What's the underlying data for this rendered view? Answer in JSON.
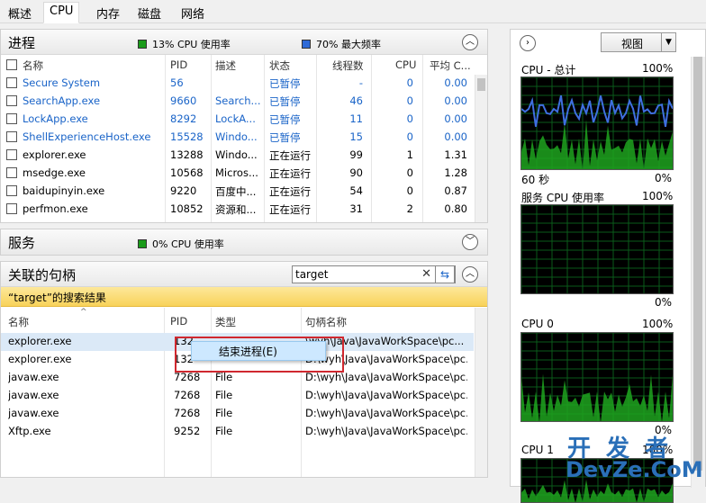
{
  "tabs": [
    "概述",
    "CPU",
    "内存",
    "磁盘",
    "网络"
  ],
  "active_tab": "CPU",
  "processes": {
    "title": "进程",
    "cpu_usage": "13% CPU 使用率",
    "max_freq": "70% 最大频率",
    "columns": [
      "名称",
      "PID",
      "描述",
      "状态",
      "线程数",
      "CPU",
      "平均 C..."
    ],
    "rows": [
      {
        "name": "Secure System",
        "pid": "56",
        "desc": "",
        "status": "已暂停",
        "threads": "-",
        "cpu": "0",
        "avg": "0.00",
        "blue": true
      },
      {
        "name": "SearchApp.exe",
        "pid": "9660",
        "desc": "Search...",
        "status": "已暂停",
        "threads": "46",
        "cpu": "0",
        "avg": "0.00",
        "blue": true
      },
      {
        "name": "LockApp.exe",
        "pid": "8292",
        "desc": "LockA...",
        "status": "已暂停",
        "threads": "11",
        "cpu": "0",
        "avg": "0.00",
        "blue": true
      },
      {
        "name": "ShellExperienceHost.exe",
        "pid": "15528",
        "desc": "Windo...",
        "status": "已暂停",
        "threads": "15",
        "cpu": "0",
        "avg": "0.00",
        "blue": true
      },
      {
        "name": "explorer.exe",
        "pid": "13288",
        "desc": "Windo...",
        "status": "正在运行",
        "threads": "99",
        "cpu": "1",
        "avg": "1.31",
        "blue": false
      },
      {
        "name": "msedge.exe",
        "pid": "10568",
        "desc": "Micros...",
        "status": "正在运行",
        "threads": "90",
        "cpu": "0",
        "avg": "1.28",
        "blue": false
      },
      {
        "name": "baidupinyin.exe",
        "pid": "9220",
        "desc": "百度中...",
        "status": "正在运行",
        "threads": "54",
        "cpu": "0",
        "avg": "0.87",
        "blue": false
      },
      {
        "name": "perfmon.exe",
        "pid": "10852",
        "desc": "资源和...",
        "status": "正在运行",
        "threads": "31",
        "cpu": "2",
        "avg": "0.80",
        "blue": false
      }
    ]
  },
  "services": {
    "title": "服务",
    "cpu_usage": "0% CPU 使用率"
  },
  "handles": {
    "title": "关联的句柄",
    "search_value": "target",
    "result_banner": "“target”的搜索结果",
    "columns": [
      "名称",
      "PID",
      "类型",
      "句柄名称"
    ],
    "rows": [
      {
        "name": "explorer.exe",
        "pid": "132",
        "type": "",
        "handle": "\\wyh\\Java\\JavaWorkSpace\\pc..."
      },
      {
        "name": "explorer.exe",
        "pid": "132",
        "type": "",
        "handle": "D:\\wyh\\Java\\JavaWorkSpace\\pc..."
      },
      {
        "name": "javaw.exe",
        "pid": "7268",
        "type": "File",
        "handle": "D:\\wyh\\Java\\JavaWorkSpace\\pc..."
      },
      {
        "name": "javaw.exe",
        "pid": "7268",
        "type": "File",
        "handle": "D:\\wyh\\Java\\JavaWorkSpace\\pc..."
      },
      {
        "name": "javaw.exe",
        "pid": "7268",
        "type": "File",
        "handle": "D:\\wyh\\Java\\JavaWorkSpace\\pc..."
      },
      {
        "name": "Xftp.exe",
        "pid": "9252",
        "type": "File",
        "handle": "D:\\wyh\\Java\\JavaWorkSpace\\pc..."
      }
    ]
  },
  "context_menu": {
    "item": "结束进程(E)"
  },
  "right_panel": {
    "view_label": "视图",
    "graphs": [
      {
        "title": "CPU - 总计",
        "top": "100%",
        "bottom_left": "60 秒",
        "bottom_right": "0%"
      },
      {
        "title": "服务 CPU 使用率",
        "top": "100%",
        "bottom_left": "",
        "bottom_right": "0%"
      },
      {
        "title": "CPU 0",
        "top": "100%",
        "bottom_left": "",
        "bottom_right": "0%"
      },
      {
        "title": "CPU 1",
        "top": "100%",
        "bottom_left": "",
        "bottom_right": ""
      }
    ]
  },
  "watermark": {
    "line1": "开 发 者",
    "line2": "DevZe.CoM"
  },
  "colors": {
    "cpu_green": "#1a9b1a",
    "freq_blue": "#2f6bd8",
    "banner": "#f8d35a",
    "graph_bg": "#000000"
  }
}
